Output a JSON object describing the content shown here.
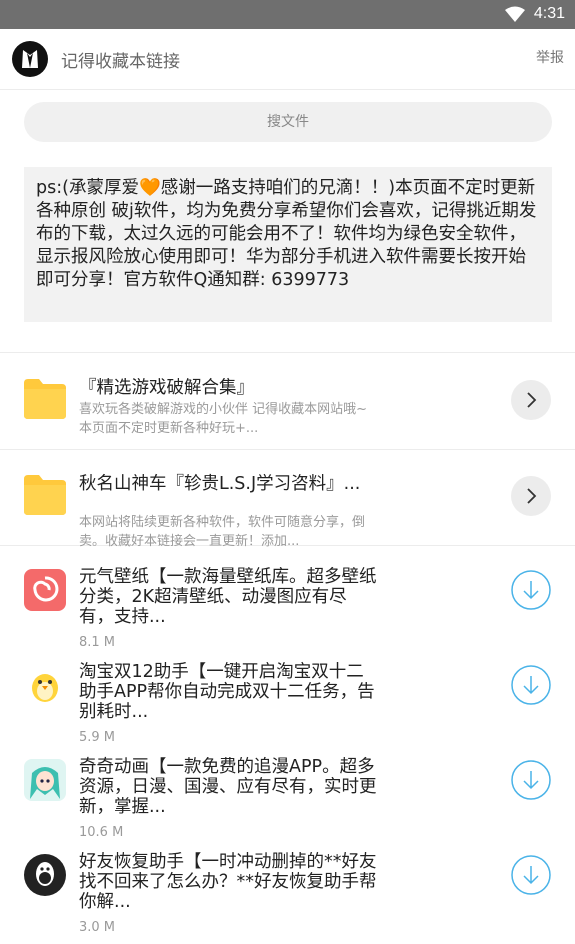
{
  "status": {
    "time": "4:31"
  },
  "header": {
    "title": "记得收藏本链接",
    "report": "举报"
  },
  "search": {
    "placeholder": "搜文件"
  },
  "notice": {
    "prefix": "ps:(承蒙厚爱",
    "heart": "🧡",
    "body": "感谢一路支持咱们的兄滴！！)本页面不定时更新各种原创 破j软件，均为免费分享希望你们会喜欢，记得挑近期发布的下载，太过久远的可能会用不了！软件均为绿色安全软件，显示报风险放心使用即可！华为部分手机进入软件需要长按开始即可分享！官方软件Q通知群: 6399773"
  },
  "folders": [
    {
      "title": "『精选游戏破解合集』",
      "desc": "喜欢玩各类破解游戏的小伙伴 记得收藏本网站哦~本页面不定时更新各种好玩+..."
    },
    {
      "title": "秋名山神车『轸贵L.S.J学习咨料』...",
      "desc": "本网站将陆续更新各种软件，软件可随意分享，倒卖。收藏好本链接会一直更新！添加..."
    }
  ],
  "apps": [
    {
      "title": "元气壁纸【一款海量壁纸库。超多壁纸分类，2K超清壁纸、动漫图应有尽有，支持...",
      "size": "8.1 M",
      "icon": "yuanqi-wallpaper-icon",
      "color": "#f46a6a"
    },
    {
      "title": "淘宝双12助手【一键开启淘宝双十二助手APP帮你自动完成双十二任务，告别耗时...",
      "size": "5.9 M",
      "icon": "penguin-icon",
      "color": "#ffd43b"
    },
    {
      "title": "奇奇动画【一款免费的追漫APP。超多资源，日漫、国漫、应有尽有，实时更新，掌握...",
      "size": "10.6 M",
      "icon": "anime-girl-icon",
      "color": "#3dbfb0"
    },
    {
      "title": "好友恢复助手【一时冲动删掉的**好友找不回来了怎么办？**好友恢复助手帮你解...",
      "size": "3.0 M",
      "icon": "qq-penguin-icon",
      "color": "#222222"
    }
  ],
  "colors": {
    "accent": "#4ab3e8",
    "folder": "#ffc93c",
    "statusbar": "#6f6f6f"
  }
}
